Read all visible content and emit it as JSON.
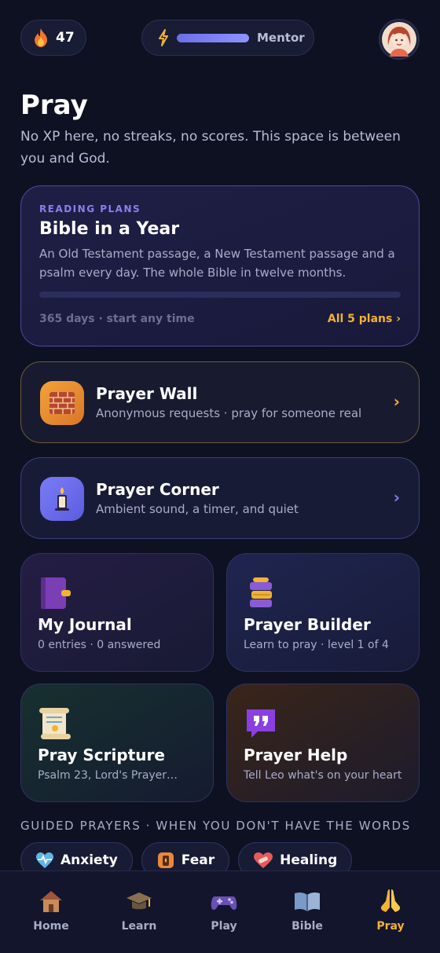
{
  "topbar": {
    "streak_count": "47",
    "streak_icon": "flame-icon",
    "mentor_label": "Mentor",
    "mentor_progress": 1.0
  },
  "page": {
    "title": "Pray",
    "subtitle": "No XP here, no streaks, no scores. This space is between you and God."
  },
  "reading_plan": {
    "eyebrow": "READING PLANS",
    "title": "Bible in a Year",
    "description": "An Old Testament passage, a New Testament passage and a psalm every day. The whole Bible in twelve months.",
    "progress": 0.0,
    "meta": "365 days · start any time",
    "link": "All 5 plans ›"
  },
  "prayer_wall": {
    "title": "Prayer Wall",
    "description": "Anonymous requests · pray for someone real",
    "icon": "brick-wall-icon",
    "chevron": "›"
  },
  "prayer_corner": {
    "title": "Prayer Corner",
    "description": "Ambient sound, a timer, and quiet",
    "icon": "candle-icon",
    "chevron": "›"
  },
  "tiles": {
    "journal": {
      "title": "My Journal",
      "description": "0 entries · 0 answered",
      "icon": "journal-icon"
    },
    "builder": {
      "title": "Prayer Builder",
      "description": "Learn to pray · level 1 of 4",
      "icon": "stacked-books-icon"
    },
    "scripture": {
      "title": "Pray Scripture",
      "description": "Psalm 23, Lord's Prayer…",
      "icon": "scroll-icon"
    },
    "help": {
      "title": "Prayer Help",
      "description": "Tell Leo what's on your heart",
      "icon": "quote-bubble-icon"
    }
  },
  "guided": {
    "heading": "GUIDED PRAYERS · WHEN YOU DON'T HAVE THE WORDS",
    "chips": [
      {
        "label": "Anxiety",
        "icon": "heart-pulse-icon"
      },
      {
        "label": "Fear",
        "icon": "lantern-icon"
      },
      {
        "label": "Healing",
        "icon": "bandaged-heart-icon"
      }
    ]
  },
  "nav": {
    "items": [
      {
        "label": "Home",
        "icon": "house-icon"
      },
      {
        "label": "Learn",
        "icon": "graduation-cap-icon"
      },
      {
        "label": "Play",
        "icon": "gamepad-icon"
      },
      {
        "label": "Bible",
        "icon": "open-book-icon"
      },
      {
        "label": "Pray",
        "icon": "praying-hands-icon"
      }
    ],
    "active": "Pray"
  },
  "colors": {
    "background": "#0e1121",
    "accent_purple": "#8b7ff0",
    "accent_gold": "#f2b233"
  }
}
